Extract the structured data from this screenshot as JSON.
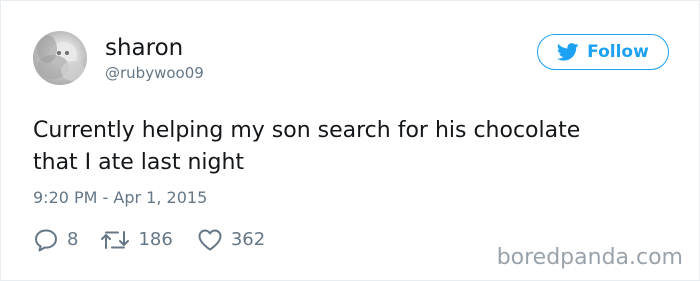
{
  "user": {
    "name": "sharon",
    "handle": "@rubywoo09"
  },
  "follow_button": {
    "label": "Follow",
    "icon": "twitter-bird-icon"
  },
  "tweet": {
    "lines": [
      "Currently helping my son search for his chocolate",
      "that I ate last night"
    ],
    "timestamp": "9:20 PM - Apr 1, 2015"
  },
  "actions": {
    "replies": {
      "icon": "reply-icon",
      "count": "8"
    },
    "retweets": {
      "icon": "retweet-icon",
      "count": "186"
    },
    "likes": {
      "icon": "heart-icon",
      "count": "362"
    }
  },
  "watermark": "boredpanda.com",
  "colors": {
    "accent": "#1da1f2",
    "text": "#14171a",
    "muted": "#657786",
    "watermark": "#9aa3ab"
  }
}
